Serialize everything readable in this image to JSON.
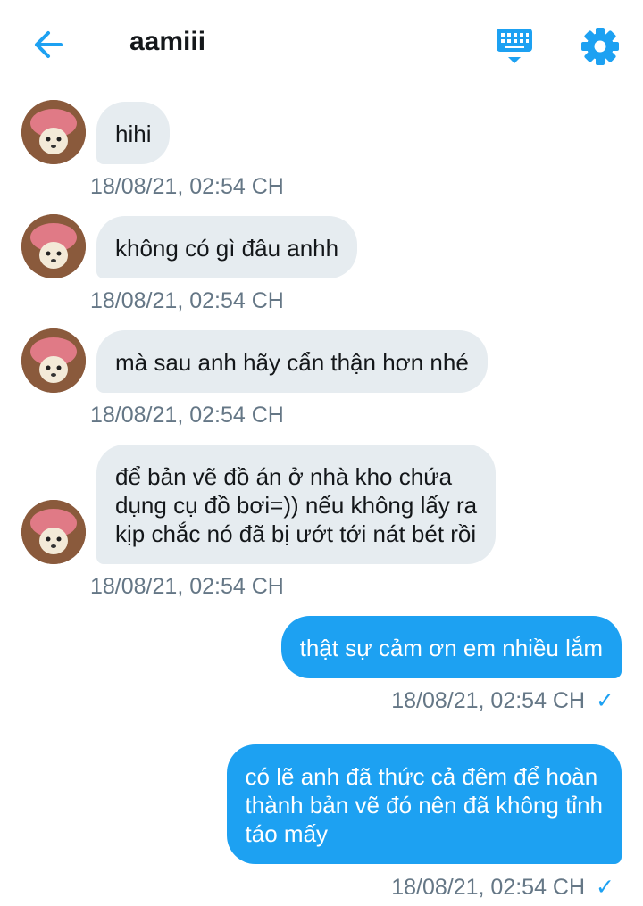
{
  "header": {
    "title": "aamiii",
    "back_icon": "back-arrow-icon",
    "keyboard_icon": "keyboard-icon",
    "settings_icon": "gear-icon",
    "accent": "#1da1f2"
  },
  "messages": [
    {
      "text": "hihi",
      "time": "18/08/21, 02:54 CH"
    },
    {
      "text": "không có gì đâu anhh",
      "time": "18/08/21, 02:54 CH"
    },
    {
      "text": "mà sau anh hãy cẩn thận hơn nhé",
      "time": "18/08/21, 02:54 CH"
    },
    {
      "text": "để bản vẽ đồ án ở nhà kho chứa\ndụng cụ đồ bơi=)) nếu không lấy ra\nkịp chắc nó đã bị ướt tới nát bét rồi",
      "time": "18/08/21, 02:54 CH"
    },
    {
      "text": "thật sự cảm ơn em nhiều lắm",
      "time": "18/08/21, 02:54 CH",
      "status": "✓"
    },
    {
      "text": "có lẽ anh đã thức cả đêm để hoàn\nthành bản vẽ đó nên đã không tỉnh\ntáo mấy",
      "time": "18/08/21, 02:54 CH",
      "status": "✓"
    }
  ]
}
